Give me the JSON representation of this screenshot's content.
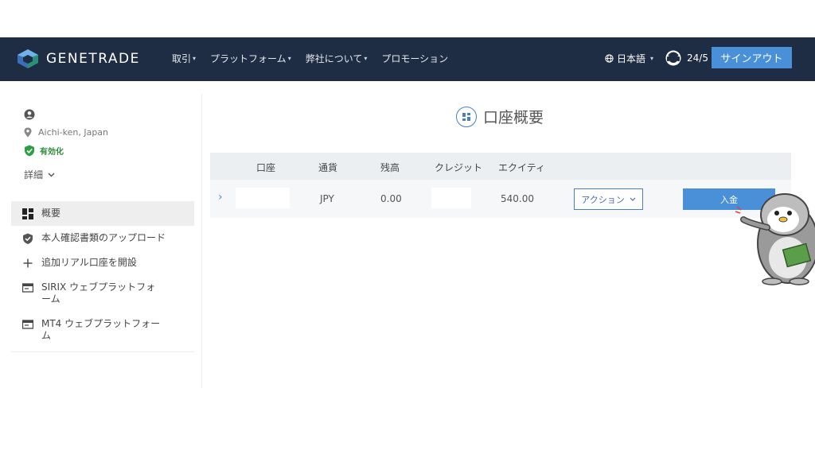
{
  "header": {
    "logo_text": "GENETRADE",
    "nav": [
      {
        "label": "取引",
        "has_caret": true
      },
      {
        "label": "プラットフォーム",
        "has_caret": true
      },
      {
        "label": "弊社について",
        "has_caret": true
      },
      {
        "label": "プロモーション",
        "has_caret": false
      }
    ],
    "language": "日本語",
    "support_label": "24/5",
    "signout_label": "サインアウト"
  },
  "sidebar": {
    "location": "Aichi-ken, Japan",
    "status": "有効化",
    "details_label": "詳細",
    "items": [
      {
        "label": "概要",
        "icon": "dashboard-icon",
        "active": true
      },
      {
        "label": "本人確認書類のアップロード",
        "icon": "shield-icon",
        "active": false
      },
      {
        "label": "追加リアル口座を開設",
        "icon": "plus-icon",
        "active": false
      },
      {
        "label": "SIRIX ウェブプラットフォーム",
        "icon": "browser-window-icon",
        "active": false
      },
      {
        "label": "MT4 ウェブプラットフォーム",
        "icon": "browser-window-icon",
        "active": false
      }
    ]
  },
  "main": {
    "title": "口座概要",
    "columns": [
      "口座",
      "通貨",
      "残高",
      "クレジット",
      "エクイティ"
    ],
    "row": {
      "account": "",
      "currency": "JPY",
      "balance": "0.00",
      "credit": "",
      "equity": "540.00",
      "action_label": "アクション",
      "deposit_label": "入金"
    }
  },
  "colors": {
    "topbar": "#1f2d44",
    "accent": "#4a90d9",
    "verified": "#2e8b3a"
  }
}
